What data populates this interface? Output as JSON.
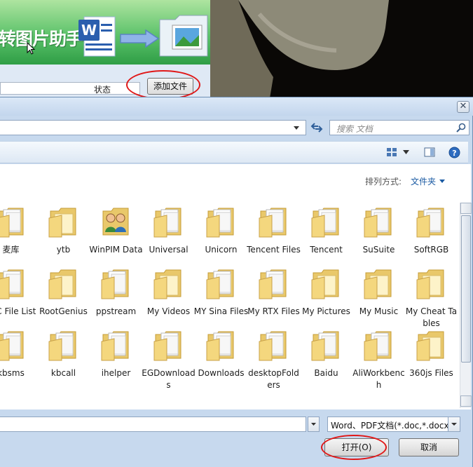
{
  "background_app": {
    "banner_title": "转图片助手",
    "status_column": "状态",
    "add_file_button": "添加文件"
  },
  "dialog": {
    "search_placeholder": "搜索 文档",
    "arrange_label": "排列方式:",
    "arrange_value": "文件夹",
    "filetype_value": "Word、PDF文档(*.doc,*.docx",
    "open_button": "打开(O)",
    "cancel_button": "取消",
    "close_glyph": "✕"
  },
  "folders": [
    {
      "label": "麦库",
      "icon": "document-folder-icon"
    },
    {
      "label": "ytb",
      "icon": "folder-icon"
    },
    {
      "label": "WinPIM Data",
      "icon": "contacts-folder-icon"
    },
    {
      "label": "Universal",
      "icon": "document-folder-icon"
    },
    {
      "label": "Unicorn",
      "icon": "document-folder-icon"
    },
    {
      "label": "Tencent Files",
      "icon": "document-folder-icon"
    },
    {
      "label": "Tencent",
      "icon": "document-folder-icon"
    },
    {
      "label": "SuSuite",
      "icon": "document-folder-icon"
    },
    {
      "label": "SoftRGB",
      "icon": "document-folder-icon"
    },
    {
      "label": "TXC File List",
      "icon": "document-folder-icon"
    },
    {
      "label": "RootGenius",
      "icon": "folder-icon"
    },
    {
      "label": "ppstream",
      "icon": "document-folder-icon"
    },
    {
      "label": "My Videos",
      "icon": "folder-icon"
    },
    {
      "label": "MY Sina Files",
      "icon": "document-folder-icon"
    },
    {
      "label": "My RTX Files",
      "icon": "document-folder-icon"
    },
    {
      "label": "My Pictures",
      "icon": "folder-icon"
    },
    {
      "label": "My Music",
      "icon": "folder-icon"
    },
    {
      "label": "My Cheat Tables",
      "icon": "folder-icon"
    },
    {
      "label": "kbsms",
      "icon": "document-folder-icon"
    },
    {
      "label": "kbcall",
      "icon": "document-folder-icon"
    },
    {
      "label": "ihelper",
      "icon": "document-folder-icon"
    },
    {
      "label": "EGDownloads",
      "icon": "document-folder-icon"
    },
    {
      "label": "Downloads",
      "icon": "document-folder-icon"
    },
    {
      "label": "desktopFolders",
      "icon": "document-folder-icon"
    },
    {
      "label": "Baidu",
      "icon": "document-folder-icon"
    },
    {
      "label": "AliWorkbench",
      "icon": "document-folder-icon"
    },
    {
      "label": "360js Files",
      "icon": "folder-icon"
    }
  ],
  "colors": {
    "annotation": "#e01818",
    "link_blue": "#1a5aa3"
  }
}
